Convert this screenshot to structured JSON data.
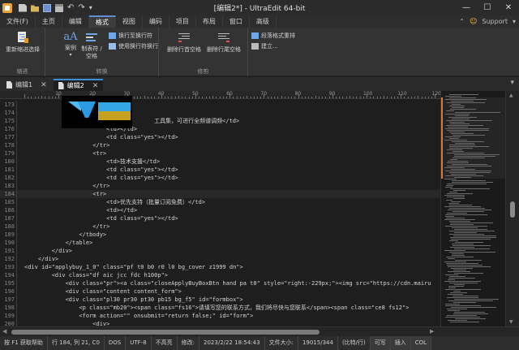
{
  "window": {
    "title": "[编辑2*] - UltraEdit 64-bit"
  },
  "menu": {
    "items": [
      "文件(F)",
      "主页",
      "编辑",
      "格式",
      "视图",
      "编码",
      "项目",
      "布局",
      "窗口",
      "高级"
    ],
    "active_index": 3,
    "support_label": "Support"
  },
  "ribbon": {
    "group1": {
      "label": "缩进",
      "btn_reindent": "重新缩进选择"
    },
    "group2": {
      "label": "转换",
      "btn_case": "案例",
      "btn_tabs": "制表符 / 空格",
      "btn_wrap_to_line": "换行至换行符",
      "btn_use_wrap": "使用换行符换行"
    },
    "group3": {
      "label": "修剪",
      "btn_trim_leading": "删除行首空格",
      "btn_trim_trailing": "删除行尾空格"
    },
    "group4": {
      "label": "",
      "btn_para_reformat": "段落格式重排",
      "btn_create": "建立..."
    }
  },
  "tabs": [
    {
      "label": "编辑1",
      "active": false
    },
    {
      "label": "编辑2",
      "active": true
    }
  ],
  "ruler": {
    "labels": [
      "10",
      "20",
      "30",
      "40",
      "50",
      "60",
      "70",
      "80",
      "90",
      "100",
      "110",
      "120"
    ]
  },
  "editor": {
    "current_line": 184,
    "lines": [
      {
        "n": "173",
        "text": ""
      },
      {
        "n": "174",
        "text": ""
      },
      {
        "n": "175",
        "text": "                                      工具集，可进行全频谱调频</td>"
      },
      {
        "n": "176",
        "text": "                        <td></td>"
      },
      {
        "n": "177",
        "text": "                        <td class=\"yes\"></td>"
      },
      {
        "n": "178",
        "text": "                    </tr>"
      },
      {
        "n": "179",
        "text": "                    <tr>"
      },
      {
        "n": "180",
        "text": "                        <td>技术支援</td>"
      },
      {
        "n": "181",
        "text": "                        <td class=\"yes\"></td>"
      },
      {
        "n": "182",
        "text": "                        <td class=\"yes\"></td>"
      },
      {
        "n": "183",
        "text": "                    </tr>"
      },
      {
        "n": "184",
        "text": "                    <tr>"
      },
      {
        "n": "185",
        "text": "                        <td>优先支持（批量订阅免费）</td>"
      },
      {
        "n": "186",
        "text": "                        <td></td>"
      },
      {
        "n": "187",
        "text": "                        <td class=\"yes\"></td>"
      },
      {
        "n": "188",
        "text": "                    </tr>"
      },
      {
        "n": "189",
        "text": "                </tbody>"
      },
      {
        "n": "190",
        "text": "            </table>"
      },
      {
        "n": "191",
        "text": "        </div>"
      },
      {
        "n": "192",
        "text": "    </div>"
      },
      {
        "n": "193",
        "text": "<div id=\"applybuy_1_0\" class=\"pf t0 b0 r0 l0 bg_cover z1999 dn\">"
      },
      {
        "n": "194",
        "text": "        <div class=\"df aic jcc fdc h100p\">"
      },
      {
        "n": "195",
        "text": "            <div class=\"pr\"><a class=\"closeApplyBuyBoxBtn hand pa t0\" style=\"right:-229px;\"><img src=\"https://cdn.mairu"
      },
      {
        "n": "196",
        "text": "            <div class=\"content content_form\">"
      },
      {
        "n": "197",
        "text": "            <div class=\"pl30 pr30 pt30 pb15 bg_f5\" id=\"formbox\">"
      },
      {
        "n": "198",
        "text": "                <p class=\"mb20\"><span class=\"fs16\">请填写您的联系方式，我们将尽快与您联系</span><span class=\"ce8 fs12\">"
      },
      {
        "n": "199",
        "text": "                <form action=\"\" onsubmit=\"return false;\" id=\"form\">"
      },
      {
        "n": "200",
        "text": "                    <div>"
      },
      {
        "n": "201",
        "text": "                        <input type=\"text\" name=\"company\" class=\"w100p star\" placeholder=\"公司名称\">"
      }
    ]
  },
  "status": {
    "help": "按 F1 获取帮助",
    "position": "行 184, 列 21, C0",
    "line_ending": "DOS",
    "encoding": "UTF-8",
    "highlight": "不高亮",
    "modified": "修改:",
    "timestamp": "2023/2/22 18:54:43",
    "filesize": "文件大小:",
    "size_value": "19015/344",
    "writable": "(比特/行)",
    "rw": "可写",
    "insert": "插入",
    "col": "COL"
  }
}
